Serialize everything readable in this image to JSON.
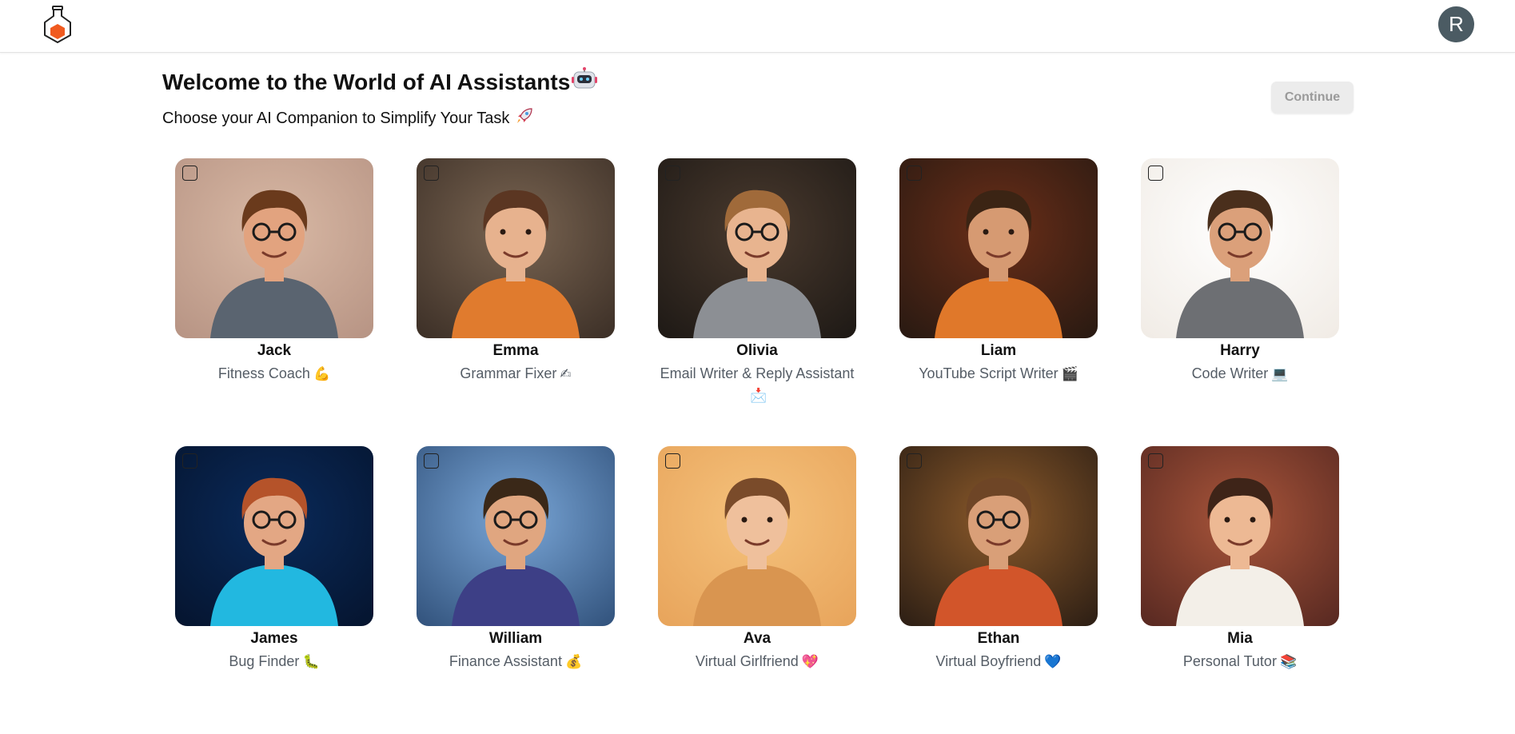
{
  "header": {
    "avatar_initial": "R",
    "brand_color": "#f05a1f"
  },
  "page": {
    "title": "Welcome to the World of AI Assistants",
    "title_emoji": "🤖",
    "subtitle": "Choose your AI Companion to Simplify Your Task",
    "subtitle_emoji": "🚀",
    "continue_label": "Continue"
  },
  "assistants": [
    {
      "name": "Jack",
      "role": "Fitness Coach",
      "emoji": "💪",
      "selected": false,
      "bg": [
        "#d9b9a5",
        "#b89585"
      ],
      "skin": "#e2a37f",
      "hair": "#6a3a1c",
      "shirt": "#5a6470",
      "glasses": true
    },
    {
      "name": "Emma",
      "role": "Grammar Fixer",
      "emoji": "✍",
      "selected": false,
      "bg": [
        "#7a6552",
        "#3e3128"
      ],
      "skin": "#e7b28e",
      "hair": "#5b3622",
      "shirt": "#e07b2e",
      "glasses": false
    },
    {
      "name": "Olivia",
      "role": "Email Writer & Reply Assistant",
      "emoji": "📩",
      "selected": false,
      "bg": [
        "#4a3a2e",
        "#1f1a16"
      ],
      "skin": "#e8b48f",
      "hair": "#a06a3a",
      "shirt": "#8c8f94",
      "glasses": true
    },
    {
      "name": "Liam",
      "role": "YouTube Script Writer",
      "emoji": "🎬",
      "selected": false,
      "bg": [
        "#6b2e18",
        "#2a1a12"
      ],
      "skin": "#d69a72",
      "hair": "#3b2414",
      "shirt": "#e0782a",
      "glasses": false
    },
    {
      "name": "Harry",
      "role": "Code Writer",
      "emoji": "💻",
      "selected": false,
      "bg": [
        "#ffffff",
        "#f1ece6"
      ],
      "skin": "#dba07a",
      "hair": "#4a2f1c",
      "shirt": "#6d6f73",
      "glasses": true
    },
    {
      "name": "James",
      "role": "Bug Finder",
      "emoji": "🐛",
      "selected": false,
      "bg": [
        "#0a2a5a",
        "#051530"
      ],
      "skin": "#e3a784",
      "hair": "#b5532a",
      "shirt": "#22b8e0",
      "glasses": true
    },
    {
      "name": "William",
      "role": "Finance Assistant",
      "emoji": "💰",
      "selected": false,
      "bg": [
        "#7aa7d8",
        "#34557f"
      ],
      "skin": "#e0a680",
      "hair": "#3a2818",
      "shirt": "#3d3f86",
      "glasses": true
    },
    {
      "name": "Ava",
      "role": "Virtual Girlfriend",
      "emoji": "💖",
      "selected": false,
      "bg": [
        "#f5c27c",
        "#e8a55c"
      ],
      "skin": "#efc09c",
      "hair": "#7a4b2a",
      "shirt": "#d99550",
      "glasses": false
    },
    {
      "name": "Ethan",
      "role": "Virtual Boyfriend",
      "emoji": "💙",
      "selected": false,
      "bg": [
        "#8c5a2a",
        "#2f2015"
      ],
      "skin": "#d99f78",
      "hair": "#6e4526",
      "shirt": "#d2552a",
      "glasses": true
    },
    {
      "name": "Mia",
      "role": "Personal Tutor",
      "emoji": "📚",
      "selected": false,
      "bg": [
        "#a9553a",
        "#5a2a22"
      ],
      "skin": "#edb994",
      "hair": "#3e2418",
      "shirt": "#f3efe8",
      "glasses": false
    }
  ]
}
